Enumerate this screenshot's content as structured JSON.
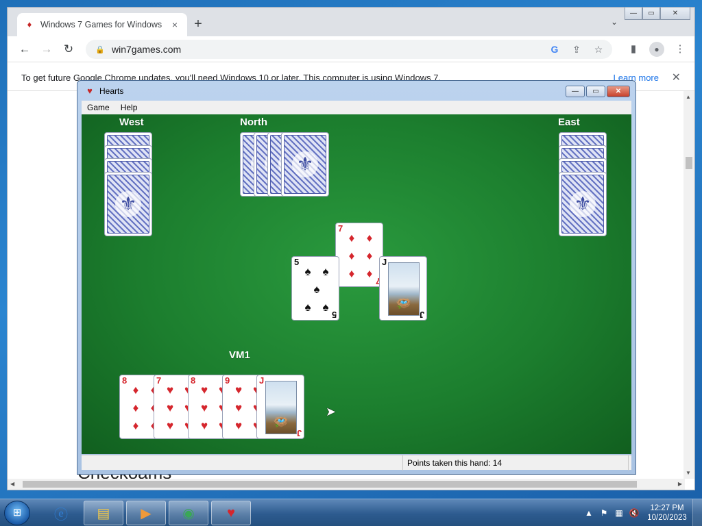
{
  "browser": {
    "tab_title": "Windows 7 Games for Windows",
    "tab_close_icon": "×",
    "new_tab_icon": "+",
    "tab_search_icon": "⌄",
    "url": "win7games.com",
    "infobar_text": "To get future Google Chrome updates, you'll need Windows 10 or later. This computer is using Windows 7.",
    "infobar_link": "Learn more",
    "page_bg_text": "Checkoams"
  },
  "hearts": {
    "title": "Hearts",
    "menu": [
      "Game",
      "Help"
    ],
    "players": {
      "west": "West",
      "north": "North",
      "east": "East",
      "south": "VM1"
    },
    "status": "Points taken this hand: 14",
    "trick": [
      {
        "player": "north",
        "rank": "7",
        "suit": "♦",
        "color": "red"
      },
      {
        "player": "west",
        "rank": "5",
        "suit": "♠",
        "color": "black"
      },
      {
        "player": "east",
        "rank": "J",
        "suit": "♠",
        "color": "black"
      }
    ],
    "hand": [
      {
        "rank": "8",
        "suit": "♦",
        "color": "red"
      },
      {
        "rank": "7",
        "suit": "♥",
        "color": "red"
      },
      {
        "rank": "8",
        "suit": "♥",
        "color": "red"
      },
      {
        "rank": "9",
        "suit": "♥",
        "color": "red"
      },
      {
        "rank": "J",
        "suit": "♥",
        "color": "red"
      }
    ]
  },
  "taskbar": {
    "time": "12:27 PM",
    "date": "10/20/2023",
    "apps": [
      "internet-explorer",
      "file-explorer",
      "media-player",
      "chrome",
      "hearts"
    ]
  },
  "colors": {
    "felt": "#1c7e2e",
    "red_suit": "#d5262d",
    "link": "#1a73e8"
  }
}
